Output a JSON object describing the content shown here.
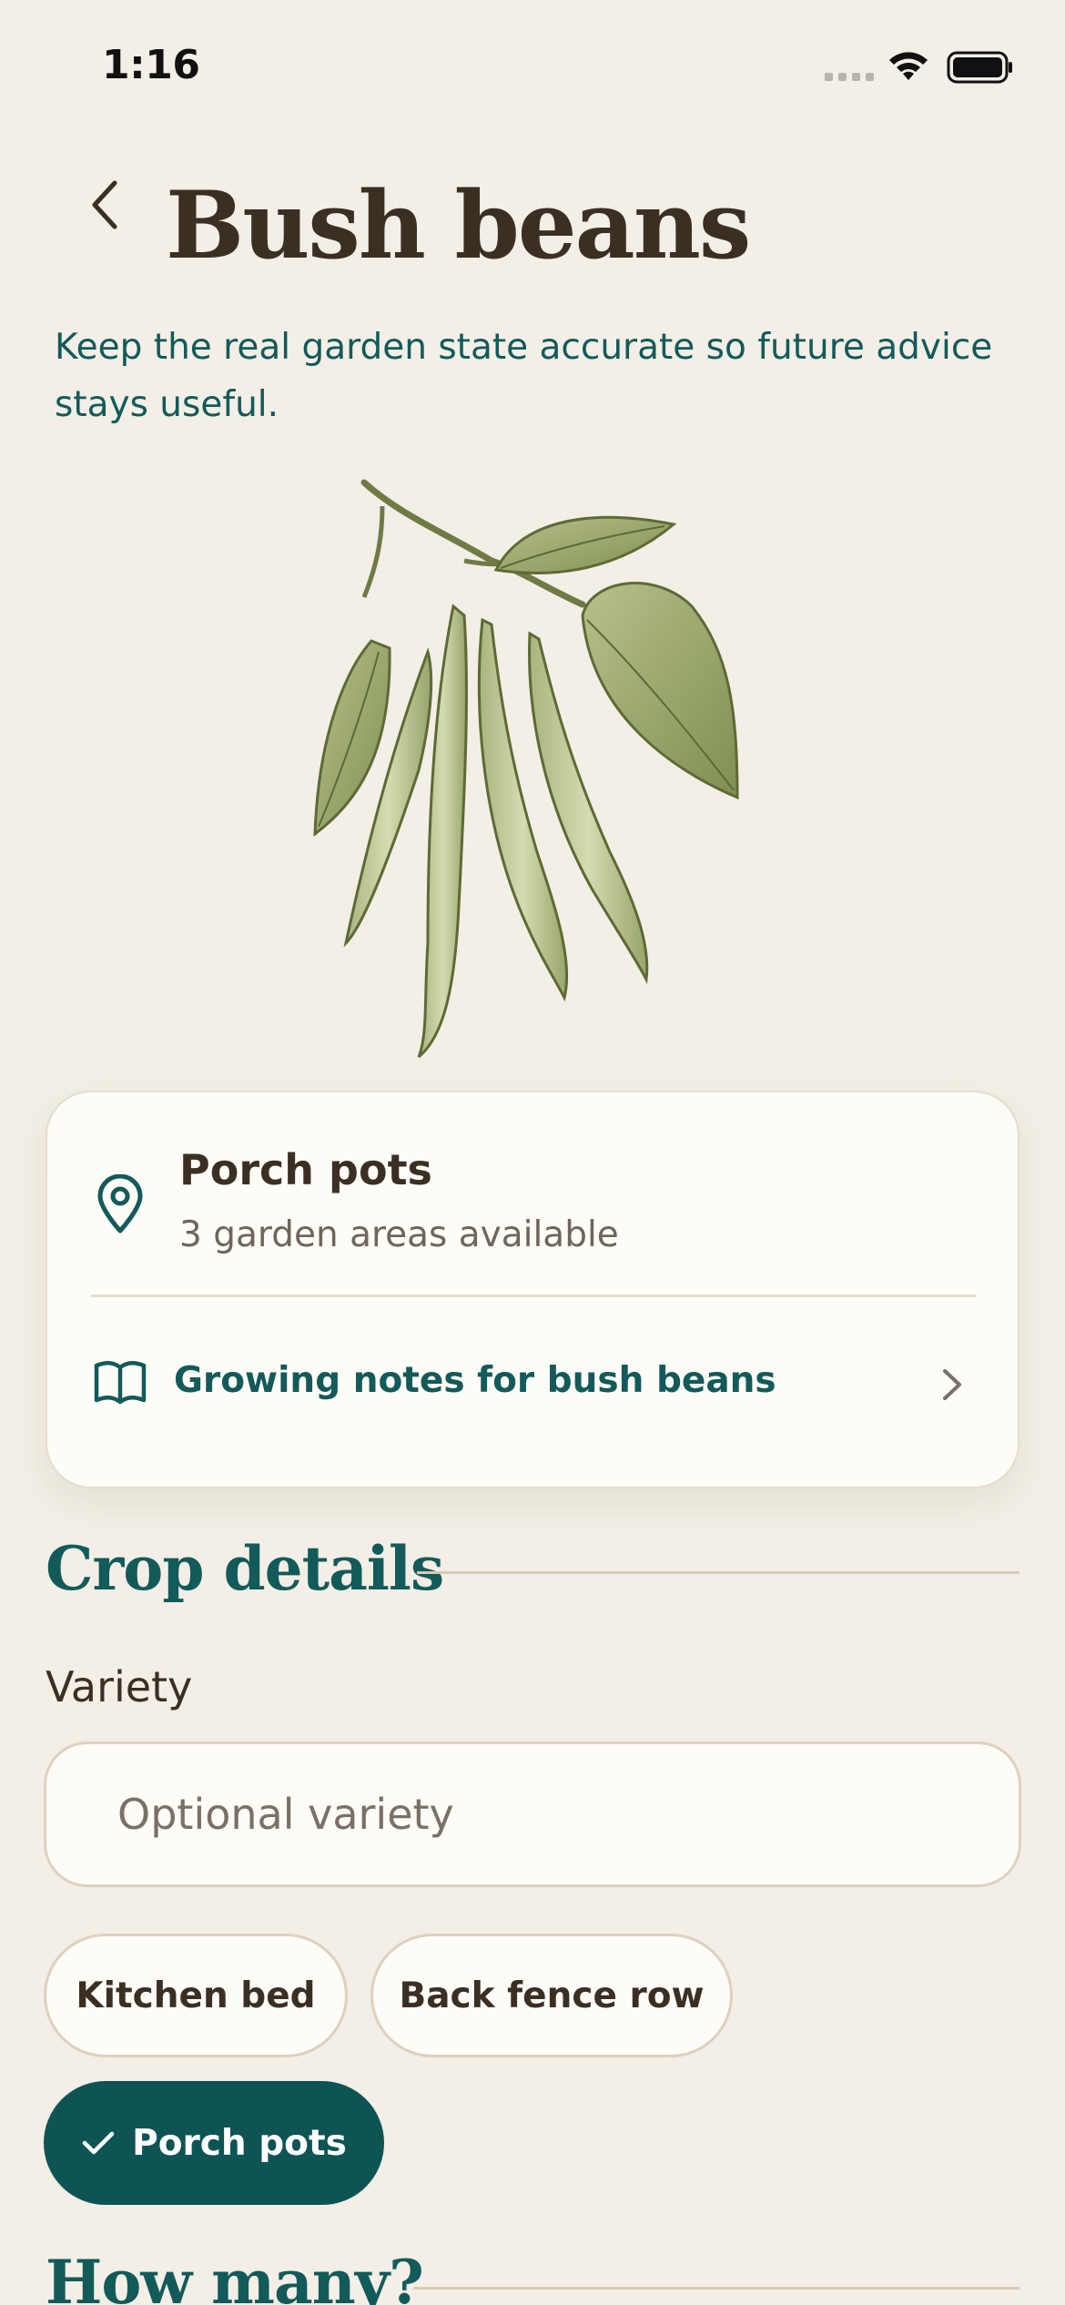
{
  "status_bar": {
    "time": "1:16"
  },
  "header": {
    "title": "Bush beans",
    "subtitle": "Keep the real garden state accurate so future advice stays useful."
  },
  "location_card": {
    "area_name": "Porch pots",
    "area_count": "3 garden areas available",
    "notes_link": "Growing notes for bush beans"
  },
  "crop_details": {
    "heading": "Crop details",
    "variety_label": "Variety",
    "variety_placeholder": "Optional variety",
    "variety_value": "",
    "area_chips": [
      {
        "label": "Kitchen bed",
        "selected": false
      },
      {
        "label": "Back fence row",
        "selected": false
      },
      {
        "label": "Porch pots",
        "selected": true
      }
    ]
  },
  "how_many": {
    "heading": "How many?"
  },
  "colors": {
    "background": "#f3efe6",
    "accent": "#0e5455",
    "title_text": "#3b2f24",
    "card": "#fdfcf7"
  },
  "icons": [
    "back-chevron-icon",
    "map-pin-icon",
    "book-icon",
    "chevron-right-icon",
    "check-icon",
    "wifi-icon",
    "battery-icon",
    "signal-icon"
  ]
}
